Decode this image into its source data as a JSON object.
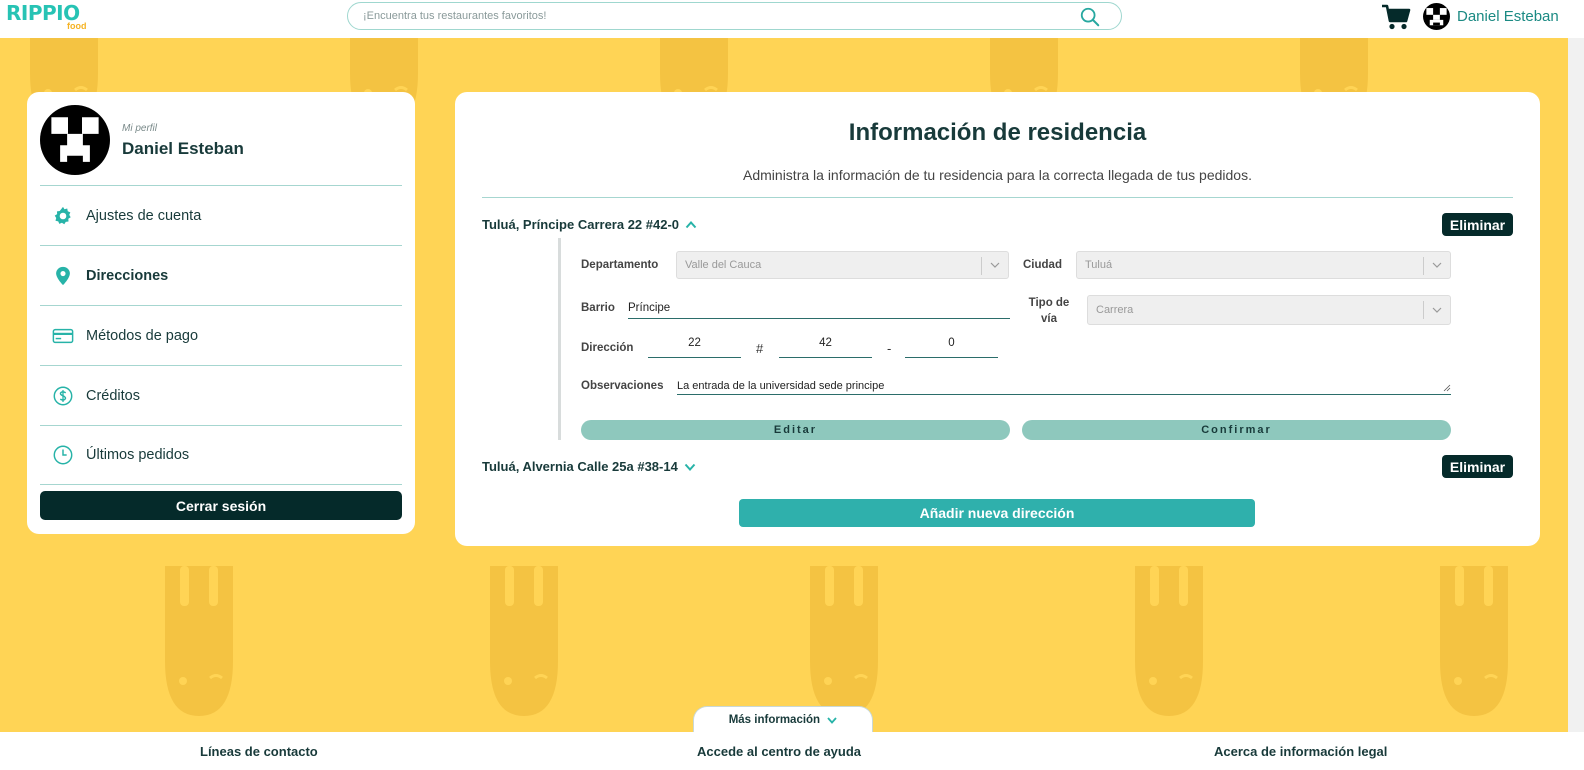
{
  "header": {
    "logo_text": "RIPPIO",
    "logo_sub": "food",
    "search_placeholder": "¡Encuentra tus restaurantes favoritos!",
    "user_name": "Daniel Esteban"
  },
  "sidebar": {
    "profile_label": "Mi perfil",
    "profile_name": "Daniel Esteban",
    "items": [
      {
        "label": "Ajustes de cuenta",
        "icon": "gear-icon"
      },
      {
        "label": "Direcciones",
        "icon": "location-pin-icon"
      },
      {
        "label": "Métodos de pago",
        "icon": "credit-card-icon"
      },
      {
        "label": "Créditos",
        "icon": "dollar-coin-icon"
      },
      {
        "label": "Últimos pedidos",
        "icon": "clock-icon"
      }
    ],
    "active_item": "Direcciones",
    "logout_label": "Cerrar sesión"
  },
  "main": {
    "title": "Información de residencia",
    "subtitle": "Administra la información de tu residencia para la correcta llegada de tus pedidos.",
    "addresses": [
      {
        "title": "Tuluá, Príncipe Carrera 22 #42-0",
        "expanded": true,
        "delete_label": "Eliminar"
      },
      {
        "title": "Tuluá, Alvernia Calle 25a #38-14",
        "expanded": false,
        "delete_label": "Eliminar"
      }
    ],
    "form": {
      "departamento_label": "Departamento",
      "departamento_value": "Valle del Cauca",
      "ciudad_label": "Ciudad",
      "ciudad_value": "Tuluá",
      "barrio_label": "Barrio",
      "barrio_value": "Príncipe",
      "tipo_via_label_1": "Tipo de",
      "tipo_via_label_2": "vía",
      "tipo_via_value": "Carrera",
      "direccion_label": "Dirección",
      "num1": "22",
      "hash": "#",
      "num2": "42",
      "dash": "-",
      "num3": "0",
      "observaciones_label": "Observaciones",
      "observaciones_value": "La entrada de la universidad sede principe",
      "edit_label": "Editar",
      "confirm_label": "Confirmar"
    },
    "add_label": "Añadir nueva dirección"
  },
  "footer": {
    "more_label": "Más información",
    "links": [
      "Líneas de contacto",
      "Accede al centro de ayuda",
      "Acerca de información legal"
    ]
  },
  "colors": {
    "accent": "#27c3b4",
    "dark": "#052a2a",
    "background": "#ffd455",
    "form_button": "#8ec8bd",
    "add_button": "#2fb0ac"
  }
}
